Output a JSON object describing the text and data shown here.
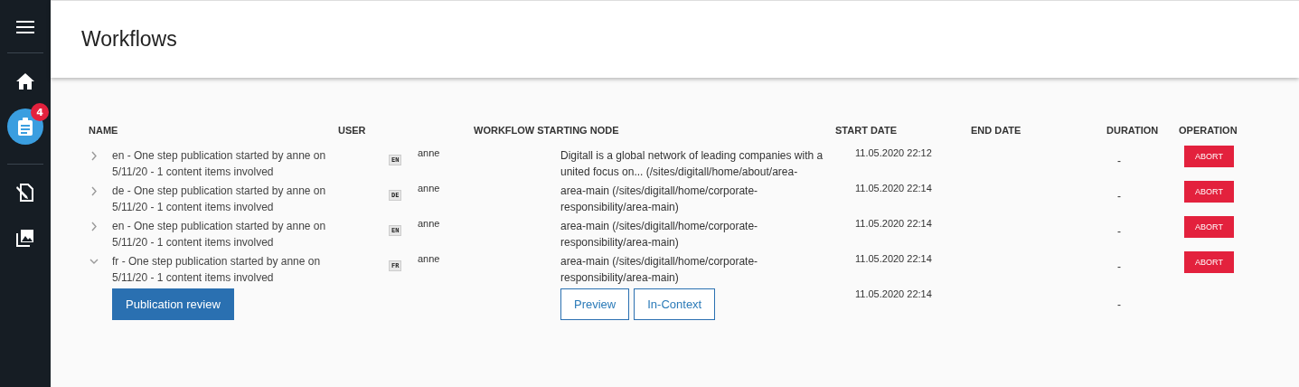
{
  "sidebar": {
    "groups": [
      [
        {
          "kind": "home",
          "selected": false
        },
        {
          "kind": "tasks",
          "selected": true,
          "badge": "4"
        }
      ],
      [
        {
          "kind": "edit",
          "selected": false
        },
        {
          "kind": "images",
          "selected": false
        }
      ]
    ]
  },
  "page": {
    "title": "Workflows"
  },
  "table": {
    "columns": [
      "NAME",
      "USER",
      "WORKFLOW STARTING NODE",
      "START DATE",
      "END DATE",
      "DURATION",
      "OPERATION"
    ],
    "rows": [
      {
        "expanded": false,
        "name": "en - One step publication started by anne on 5/11/20 - 1 content items involved",
        "language": "EN",
        "user": "anne",
        "node": "Digitall is a global network of leading companies with a united focus on... (/sites/digitall/home/about/area-",
        "start_date": "11.05.2020 22:12",
        "duration": "-",
        "operation": "ABORT"
      },
      {
        "expanded": false,
        "name": "de - One step publication started by anne on 5/11/20 - 1 content items involved",
        "language": "DE",
        "user": "anne",
        "node": "area-main (/sites/digitall/home/corporate-responsibility/area-main)",
        "start_date": "11.05.2020 22:14",
        "duration": "-",
        "operation": "ABORT"
      },
      {
        "expanded": false,
        "name": "en - One step publication started by anne on 5/11/20 - 1 content items involved",
        "language": "EN",
        "user": "anne",
        "node": "area-main (/sites/digitall/home/corporate-responsibility/area-main)",
        "start_date": "11.05.2020 22:14",
        "duration": "-",
        "operation": "ABORT"
      },
      {
        "expanded": true,
        "name": "fr - One step publication started by anne on 5/11/20 - 1 content items involved",
        "language": "FR",
        "user": "anne",
        "node": "area-main (/sites/digitall/home/corporate-responsibility/area-main)",
        "start_date": "11.05.2020 22:14",
        "duration": "-",
        "operation": "ABORT",
        "detail": {
          "review_button": "Publication review",
          "preview_button": "Preview",
          "context_button": "In-Context",
          "start_date": "11.05.2020 22:14",
          "duration": "-"
        }
      }
    ]
  }
}
